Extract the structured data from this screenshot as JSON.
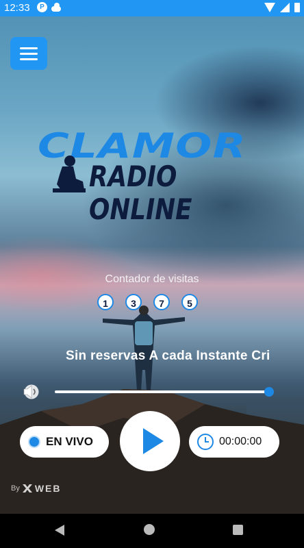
{
  "status_bar": {
    "time": "12:33",
    "icons_left": [
      "circle-p-icon",
      "cloud-icon"
    ],
    "icons_right": [
      "wifi-icon",
      "signal-icon",
      "battery-icon"
    ]
  },
  "menu": {
    "icon": "hamburger-menu-icon",
    "color": "#2196f3"
  },
  "logo": {
    "line1": "CLAMOR",
    "line2": "RADIO ONLINE"
  },
  "visits": {
    "label": "Contador de visitas",
    "digits": [
      "1",
      "3",
      "7",
      "5"
    ]
  },
  "now_playing": {
    "text": "Sin reservas A cada Instante Cri"
  },
  "volume": {
    "icon": "speaker-icon",
    "level": 1.0
  },
  "controls": {
    "live_label": "EN VIVO",
    "play_icon": "play-icon",
    "timer": "00:00:00",
    "clock_icon": "clock-icon"
  },
  "credit": {
    "by": "By",
    "brand": "WEB"
  },
  "nav": [
    "back-icon",
    "home-icon",
    "recents-icon"
  ],
  "colors": {
    "accent": "#1e88e5",
    "status_bar": "#2196f3",
    "logo_dark": "#0d1b3d"
  }
}
